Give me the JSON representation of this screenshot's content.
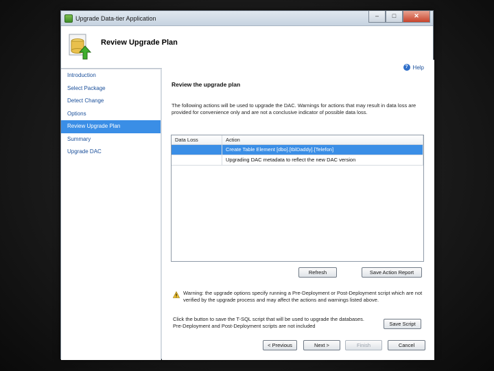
{
  "window": {
    "title": "Upgrade Data-tier Application",
    "controls": {
      "minimize": "–",
      "maximize": "□",
      "close": "✕"
    }
  },
  "header": {
    "title": "Review Upgrade Plan",
    "icon": "database-upgrade-icon"
  },
  "nav": {
    "items": [
      {
        "label": "Introduction",
        "selected": false
      },
      {
        "label": "Select Package",
        "selected": false
      },
      {
        "label": "Detect Change",
        "selected": false
      },
      {
        "label": "Options",
        "selected": false
      },
      {
        "label": "Review Upgrade Plan",
        "selected": true
      },
      {
        "label": "Summary",
        "selected": false
      },
      {
        "label": "Upgrade DAC",
        "selected": false
      }
    ]
  },
  "content": {
    "help_label": "Help",
    "section_title": "Review the upgrade plan",
    "description": "The following actions will be used to upgrade the DAC. Warnings for actions that may result in data loss are provided for convenience only and are not a conclusive indicator of possible data loss.",
    "grid": {
      "columns": [
        "Data Loss",
        "Action"
      ],
      "rows": [
        {
          "data_loss": "",
          "action": "Create Table Element [dbo].[tblDaddy].[Telefon]",
          "selected": true
        },
        {
          "data_loss": "",
          "action": "Upgrading DAC metadata to reflect the new DAC version",
          "selected": false
        }
      ]
    },
    "refresh_label": "Refresh",
    "save_report_label": "Save Action Report",
    "warning_text": "Warning: the upgrade options specify running a Pre-Deployment or Post-Deployment script which are not verified by the upgrade process and may affect the actions and warnings listed above.",
    "script_text": "Click the button to save the T-SQL script that will be used to upgrade the databases. Pre-Deployment and Post-Deployment scripts are not included",
    "save_script_label": "Save Script"
  },
  "footer": {
    "previous_label": "< Previous",
    "next_label": "Next >",
    "finish_label": "Finish",
    "cancel_label": "Cancel"
  },
  "colors": {
    "selection": "#3a8ee6",
    "link": "#1a4f9a"
  }
}
